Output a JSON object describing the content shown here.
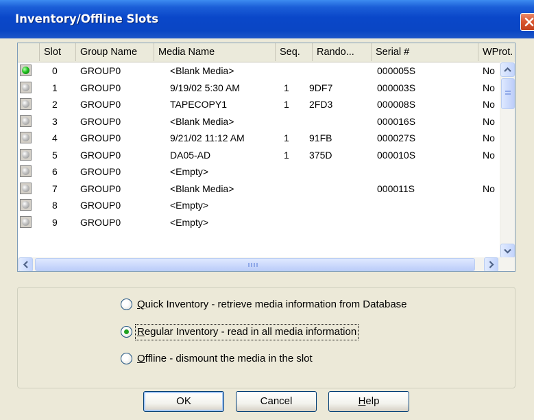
{
  "window": {
    "title": "Inventory/Offline Slots",
    "close_icon": "close-x-icon"
  },
  "table": {
    "columns": [
      "Slot",
      "Group Name",
      "Media Name",
      "Seq.",
      "Rando...",
      "Serial #",
      "WProt."
    ],
    "rows": [
      {
        "led": "green",
        "slot": "0",
        "group": "GROUP0",
        "media": "<Blank Media>",
        "seq": "",
        "rando": "",
        "serial": "000005S",
        "wprot": "No"
      },
      {
        "led": "gray",
        "slot": "1",
        "group": "GROUP0",
        "media": "9/19/02 5:30 AM",
        "seq": "1",
        "rando": "9DF7",
        "serial": "000003S",
        "wprot": "No"
      },
      {
        "led": "gray",
        "slot": "2",
        "group": "GROUP0",
        "media": "TAPECOPY1",
        "seq": "1",
        "rando": "2FD3",
        "serial": "000008S",
        "wprot": "No"
      },
      {
        "led": "gray",
        "slot": "3",
        "group": "GROUP0",
        "media": "<Blank Media>",
        "seq": "",
        "rando": "",
        "serial": "000016S",
        "wprot": "No"
      },
      {
        "led": "gray",
        "slot": "4",
        "group": "GROUP0",
        "media": "9/21/02 11:12 AM",
        "seq": "1",
        "rando": "91FB",
        "serial": "000027S",
        "wprot": "No"
      },
      {
        "led": "gray",
        "slot": "5",
        "group": "GROUP0",
        "media": "DA05-AD",
        "seq": "1",
        "rando": "375D",
        "serial": "000010S",
        "wprot": "No"
      },
      {
        "led": "gray",
        "slot": "6",
        "group": "GROUP0",
        "media": "<Empty>",
        "seq": "",
        "rando": "",
        "serial": "",
        "wprot": ""
      },
      {
        "led": "gray",
        "slot": "7",
        "group": "GROUP0",
        "media": "<Blank Media>",
        "seq": "",
        "rando": "",
        "serial": "000011S",
        "wprot": "No"
      },
      {
        "led": "gray",
        "slot": "8",
        "group": "GROUP0",
        "media": "<Empty>",
        "seq": "",
        "rando": "",
        "serial": "",
        "wprot": ""
      },
      {
        "led": "gray",
        "slot": "9",
        "group": "GROUP0",
        "media": "<Empty>",
        "seq": "",
        "rando": "",
        "serial": "",
        "wprot": ""
      }
    ]
  },
  "options": [
    {
      "mnemonic": "Q",
      "rest": "uick Inventory - retrieve media information from Database",
      "selected": false
    },
    {
      "mnemonic": "R",
      "rest": "egular Inventory - read in all media information",
      "selected": true
    },
    {
      "mnemonic": "O",
      "rest": "ffline - dismount the media in the slot",
      "selected": false
    }
  ],
  "buttons": {
    "ok": "OK",
    "cancel": "Cancel",
    "help_mnemonic": "H",
    "help_rest": "elp"
  },
  "colors": {
    "title_bar": "#0a46c4",
    "dialog_bg": "#ece9d8",
    "led_on": "#1fc01f"
  }
}
